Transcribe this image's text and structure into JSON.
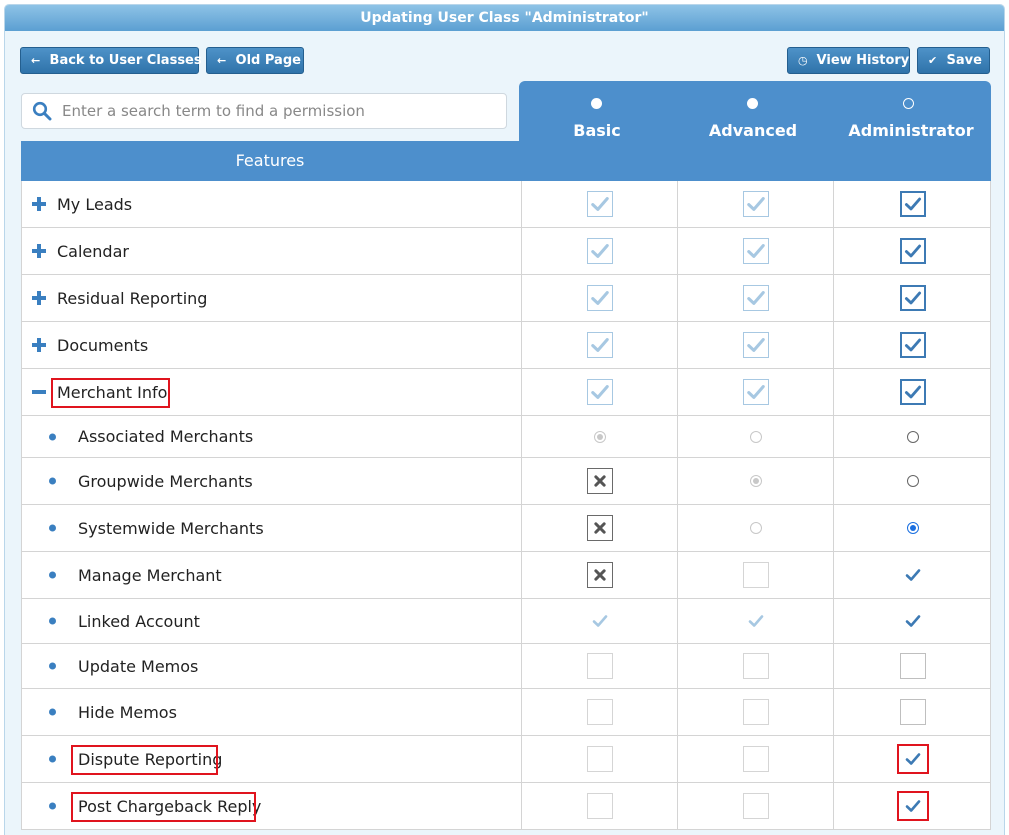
{
  "title": "Updating User Class \"Administrator\"",
  "toolbar": {
    "back_label": "Back to User Classes",
    "old_page_label": "Old Page",
    "history_label": "View History",
    "save_label": "Save"
  },
  "search": {
    "placeholder": "Enter a search term to find a permission",
    "value": ""
  },
  "columns": {
    "features": "Features",
    "basic": "Basic",
    "advanced": "Advanced",
    "administrator": "Administrator"
  },
  "rows": [
    {
      "label": "My Leads",
      "type": "group",
      "expanded": false,
      "values": [
        "faded-check",
        "faded-check",
        "checked"
      ]
    },
    {
      "label": "Calendar",
      "type": "group",
      "expanded": false,
      "values": [
        "faded-check",
        "faded-check",
        "checked"
      ]
    },
    {
      "label": "Residual Reporting",
      "type": "group",
      "expanded": false,
      "values": [
        "faded-check",
        "faded-check",
        "checked"
      ]
    },
    {
      "label": "Documents",
      "type": "group",
      "expanded": false,
      "values": [
        "faded-check",
        "faded-check",
        "checked"
      ]
    },
    {
      "label": "Merchant Info",
      "type": "group",
      "expanded": true,
      "highlighted": true,
      "values": [
        "faded-check",
        "faded-check",
        "checked"
      ]
    },
    {
      "label": "Associated Merchants",
      "type": "item",
      "values": [
        "radio-light-selected",
        "radio-light",
        "radio"
      ]
    },
    {
      "label": "Groupwide Merchants",
      "type": "item",
      "values": [
        "x",
        "radio-light-selected",
        "radio"
      ]
    },
    {
      "label": "Systemwide Merchants",
      "type": "item",
      "values": [
        "x",
        "radio-light",
        "radio-selected"
      ]
    },
    {
      "label": "Manage Merchant",
      "type": "item",
      "values": [
        "x",
        "disabled-box",
        "tick"
      ]
    },
    {
      "label": "Linked Account",
      "type": "item",
      "values": [
        "faded-tick",
        "faded-tick",
        "tick"
      ]
    },
    {
      "label": "Update Memos",
      "type": "item",
      "values": [
        "disabled-box",
        "disabled-box",
        "box"
      ]
    },
    {
      "label": "Hide Memos",
      "type": "item",
      "values": [
        "disabled-box",
        "disabled-box",
        "box"
      ]
    },
    {
      "label": "Dispute Reporting",
      "type": "item",
      "highlighted": true,
      "values": [
        "disabled-box",
        "disabled-box",
        "tick-highlighted"
      ]
    },
    {
      "label": "Post Chargeback Reply",
      "type": "item",
      "highlighted": true,
      "values": [
        "disabled-box",
        "disabled-box",
        "tick-highlighted"
      ]
    }
  ],
  "colors": {
    "header_blue": "#4d8fcc",
    "icon_blue": "#3a7fc0",
    "highlight_red": "#e0141e"
  }
}
